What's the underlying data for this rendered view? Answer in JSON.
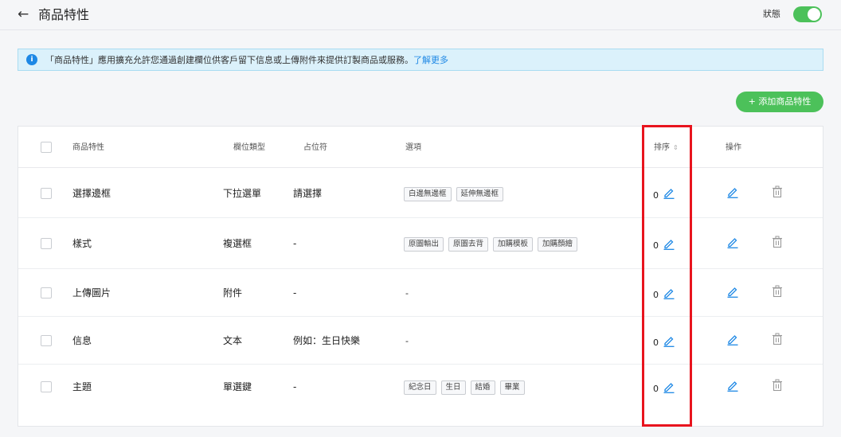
{
  "header": {
    "title": "商品特性",
    "status_label": "狀態",
    "status_on": true
  },
  "info": {
    "text": "「商品特性」應用擴充允許您通過創建欄位供客戶留下信息或上傳附件來提供訂製商品或服務。",
    "link": "了解更多"
  },
  "add_button": "+ 添加商品特性",
  "table": {
    "columns": {
      "name": "商品特性",
      "type": "欄位類型",
      "placeholder": "占位符",
      "options": "選項",
      "sort": "排序",
      "actions": "操作"
    },
    "rows": [
      {
        "name": "選擇邊框",
        "type": "下拉選單",
        "placeholder": "請選擇",
        "options": [
          "白邊無邊框",
          "延伸無邊框"
        ],
        "sort": "0"
      },
      {
        "name": "樣式",
        "type": "複選框",
        "placeholder": "-",
        "options": [
          "原圖輸出",
          "原圖去背",
          "加購模板",
          "加購顏繪"
        ],
        "sort": "0"
      },
      {
        "name": "上傳圖片",
        "type": "附件",
        "placeholder": "-",
        "options_text": "-",
        "sort": "0"
      },
      {
        "name": "信息",
        "type": "文本",
        "placeholder": "例如：生日快樂",
        "options_text": "-",
        "sort": "0"
      },
      {
        "name": "主題",
        "type": "單選鍵",
        "placeholder": "-",
        "options": [
          "紀念日",
          "生日",
          "結婚",
          "畢業"
        ],
        "sort": "0"
      }
    ]
  },
  "colors": {
    "accent_green": "#4cc15a",
    "link_blue": "#1e88e5",
    "highlight_red": "#e8141e",
    "info_bg": "#dbf1fb"
  },
  "icons": {
    "back": "arrow-left-icon",
    "info": "info-icon",
    "edit": "pencil-icon",
    "delete": "trash-icon",
    "sort": "sort-icon"
  }
}
